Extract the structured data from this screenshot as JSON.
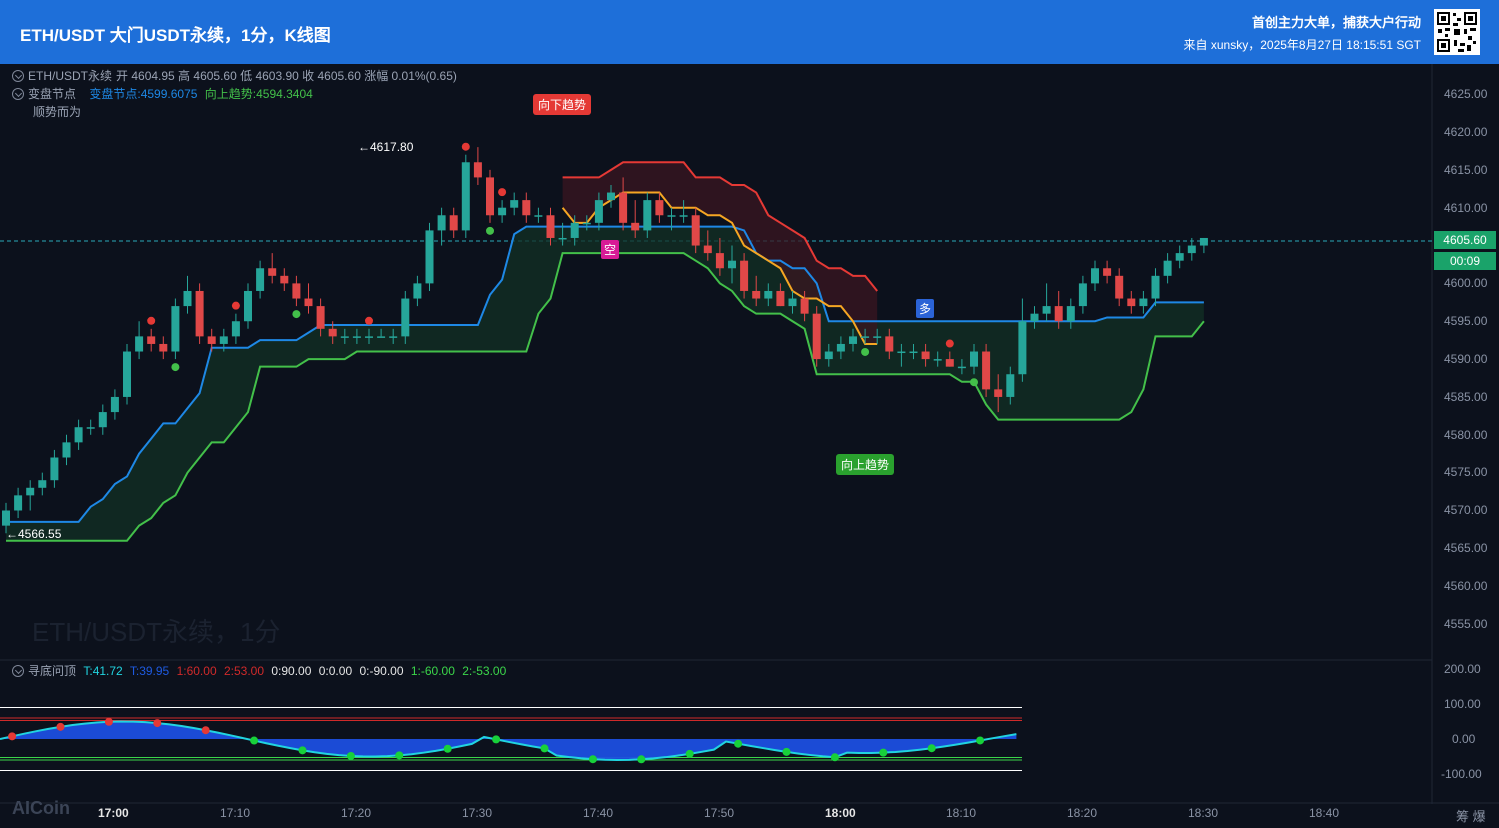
{
  "header": {
    "title": "ETH/USDT 大门USDT永续，1分，K线图",
    "slogan": "首创主力大单，捕获大户行动",
    "source": "来自 xunsky，2025年8月27日 18:15:51 SGT"
  },
  "legend": {
    "symbol": "ETH/USDT永续",
    "ohlc": "开 4604.95  高 4605.60  低 4603.90  收 4605.60  涨幅 0.01%(0.65)",
    "indicator_name": "变盘节点",
    "indicator_v1": "变盘节点:4599.6075",
    "indicator_v2": "向上趋势:4594.3404",
    "indicator_note": "顺势而为"
  },
  "watermark": "ETH/USDT永续，1分",
  "signals": {
    "down": "向下趋势",
    "up": "向上趋势",
    "short": "空",
    "long": "多"
  },
  "marks": {
    "high": "4617.80",
    "low": "4566.55",
    "last_price": "4605.60",
    "countdown": "00:09"
  },
  "osc_legend": {
    "name": "寻底问顶",
    "t1": "T:41.72",
    "t2": "T:39.95",
    "l1": "1:60.00",
    "l2": "2:53.00",
    "z1": "0:90.00",
    "z2": "0:0.00",
    "z3": "0:-90.00",
    "m1": "1:-60.00",
    "m2": "2:-53.00"
  },
  "price_axis": [
    "4625.00",
    "4620.00",
    "4615.00",
    "4610.00",
    "4600.00",
    "4595.00",
    "4590.00",
    "4585.00",
    "4580.00",
    "4575.00",
    "4570.00",
    "4565.00",
    "4560.00",
    "4555.00"
  ],
  "osc_axis": [
    "200.00",
    "100.00",
    "0.00",
    "-100.00"
  ],
  "time_axis": [
    "17:00",
    "17:10",
    "17:20",
    "17:30",
    "17:40",
    "17:50",
    "18:00",
    "18:10",
    "18:20",
    "18:30",
    "18:40"
  ],
  "footer": {
    "logo": "AICoin",
    "corner": "筹 爆"
  },
  "colors": {
    "header": "#1e6fd9",
    "up": "#26a69a",
    "down": "#e04848",
    "node": "#1e88e5",
    "trend_up": "#43c04a",
    "trend_down": "#e53935"
  },
  "chart_data": {
    "type": "candlestick",
    "interval": "1m",
    "ohlc": [
      [
        4568,
        4571,
        4567,
        4570
      ],
      [
        4570,
        4573,
        4569,
        4572
      ],
      [
        4572,
        4574,
        4570,
        4573
      ],
      [
        4573,
        4575,
        4572,
        4574
      ],
      [
        4574,
        4578,
        4573,
        4577
      ],
      [
        4577,
        4580,
        4576,
        4579
      ],
      [
        4579,
        4582,
        4578,
        4581
      ],
      [
        4581,
        4582,
        4580,
        4581
      ],
      [
        4581,
        4584,
        4580,
        4583
      ],
      [
        4583,
        4586,
        4582,
        4585
      ],
      [
        4585,
        4592,
        4584,
        4591
      ],
      [
        4591,
        4595,
        4590,
        4593
      ],
      [
        4593,
        4594,
        4591,
        4592
      ],
      [
        4592,
        4593,
        4590,
        4591
      ],
      [
        4591,
        4598,
        4590,
        4597
      ],
      [
        4597,
        4601,
        4596,
        4599
      ],
      [
        4599,
        4600,
        4592,
        4593
      ],
      [
        4593,
        4594,
        4591,
        4592
      ],
      [
        4592,
        4594,
        4591,
        4593
      ],
      [
        4593,
        4596,
        4592,
        4595
      ],
      [
        4595,
        4600,
        4594,
        4599
      ],
      [
        4599,
        4603,
        4598,
        4602
      ],
      [
        4602,
        4604,
        4600,
        4601
      ],
      [
        4601,
        4602,
        4599,
        4600
      ],
      [
        4600,
        4601,
        4597,
        4598
      ],
      [
        4598,
        4600,
        4596,
        4597
      ],
      [
        4597,
        4598,
        4593,
        4594
      ],
      [
        4594,
        4595,
        4592,
        4593
      ],
      [
        4593,
        4594,
        4592,
        4593
      ],
      [
        4593,
        4594,
        4592,
        4593
      ],
      [
        4593,
        4594,
        4592,
        4593
      ],
      [
        4593,
        4594,
        4593,
        4593
      ],
      [
        4593,
        4594,
        4592,
        4593
      ],
      [
        4593,
        4599,
        4592,
        4598
      ],
      [
        4598,
        4601,
        4597,
        4600
      ],
      [
        4600,
        4608,
        4599,
        4607
      ],
      [
        4607,
        4610,
        4605,
        4609
      ],
      [
        4609,
        4610,
        4606,
        4607
      ],
      [
        4607,
        4617,
        4606,
        4616
      ],
      [
        4616,
        4618,
        4613,
        4614
      ],
      [
        4614,
        4615,
        4608,
        4609
      ],
      [
        4609,
        4611,
        4608,
        4610
      ],
      [
        4610,
        4612,
        4609,
        4611
      ],
      [
        4611,
        4612,
        4608,
        4609
      ],
      [
        4609,
        4610,
        4608,
        4609
      ],
      [
        4609,
        4610,
        4605,
        4606
      ],
      [
        4606,
        4608,
        4605,
        4606
      ],
      [
        4606,
        4609,
        4605,
        4608
      ],
      [
        4608,
        4609,
        4607,
        4608
      ],
      [
        4608,
        4612,
        4607,
        4611
      ],
      [
        4611,
        4613,
        4610,
        4612
      ],
      [
        4612,
        4614,
        4607,
        4608
      ],
      [
        4608,
        4611,
        4606,
        4607
      ],
      [
        4607,
        4612,
        4606,
        4611
      ],
      [
        4611,
        4612,
        4608,
        4609
      ],
      [
        4609,
        4610,
        4607,
        4609
      ],
      [
        4609,
        4611,
        4608,
        4609
      ],
      [
        4609,
        4610,
        4604,
        4605
      ],
      [
        4605,
        4607,
        4603,
        4604
      ],
      [
        4604,
        4606,
        4601,
        4602
      ],
      [
        4602,
        4605,
        4600,
        4603
      ],
      [
        4603,
        4604,
        4598,
        4599
      ],
      [
        4599,
        4601,
        4597,
        4598
      ],
      [
        4598,
        4600,
        4597,
        4599
      ],
      [
        4599,
        4600,
        4597,
        4597
      ],
      [
        4597,
        4599,
        4596,
        4598
      ],
      [
        4598,
        4599,
        4595,
        4596
      ],
      [
        4596,
        4597,
        4589,
        4590
      ],
      [
        4590,
        4592,
        4589,
        4591
      ],
      [
        4591,
        4593,
        4590,
        4592
      ],
      [
        4592,
        4594,
        4591,
        4593
      ],
      [
        4593,
        4594,
        4592,
        4593
      ],
      [
        4593,
        4594,
        4592,
        4593
      ],
      [
        4593,
        4594,
        4590,
        4591
      ],
      [
        4591,
        4592,
        4589,
        4591
      ],
      [
        4591,
        4592,
        4590,
        4591
      ],
      [
        4591,
        4592,
        4589,
        4590
      ],
      [
        4590,
        4591,
        4589,
        4590
      ],
      [
        4590,
        4591,
        4589,
        4589
      ],
      [
        4589,
        4590,
        4588,
        4589
      ],
      [
        4589,
        4592,
        4588,
        4591
      ],
      [
        4591,
        4592,
        4585,
        4586
      ],
      [
        4586,
        4588,
        4583,
        4585
      ],
      [
        4585,
        4589,
        4584,
        4588
      ],
      [
        4588,
        4598,
        4587,
        4595
      ],
      [
        4595,
        4597,
        4594,
        4596
      ],
      [
        4596,
        4600,
        4595,
        4597
      ],
      [
        4597,
        4599,
        4594,
        4595
      ],
      [
        4595,
        4598,
        4594,
        4597
      ],
      [
        4597,
        4601,
        4596,
        4600
      ],
      [
        4600,
        4603,
        4599,
        4602
      ],
      [
        4602,
        4603,
        4600,
        4601
      ],
      [
        4601,
        4602,
        4597,
        4598
      ],
      [
        4598,
        4599,
        4596,
        4597
      ],
      [
        4597,
        4599,
        4596,
        4598
      ],
      [
        4598,
        4602,
        4597,
        4601
      ],
      [
        4601,
        4604,
        4600,
        4603
      ],
      [
        4603,
        4605,
        4602,
        4604
      ],
      [
        4604,
        4606,
        4603,
        4605
      ],
      [
        4605,
        4606,
        4604,
        4606
      ]
    ]
  }
}
